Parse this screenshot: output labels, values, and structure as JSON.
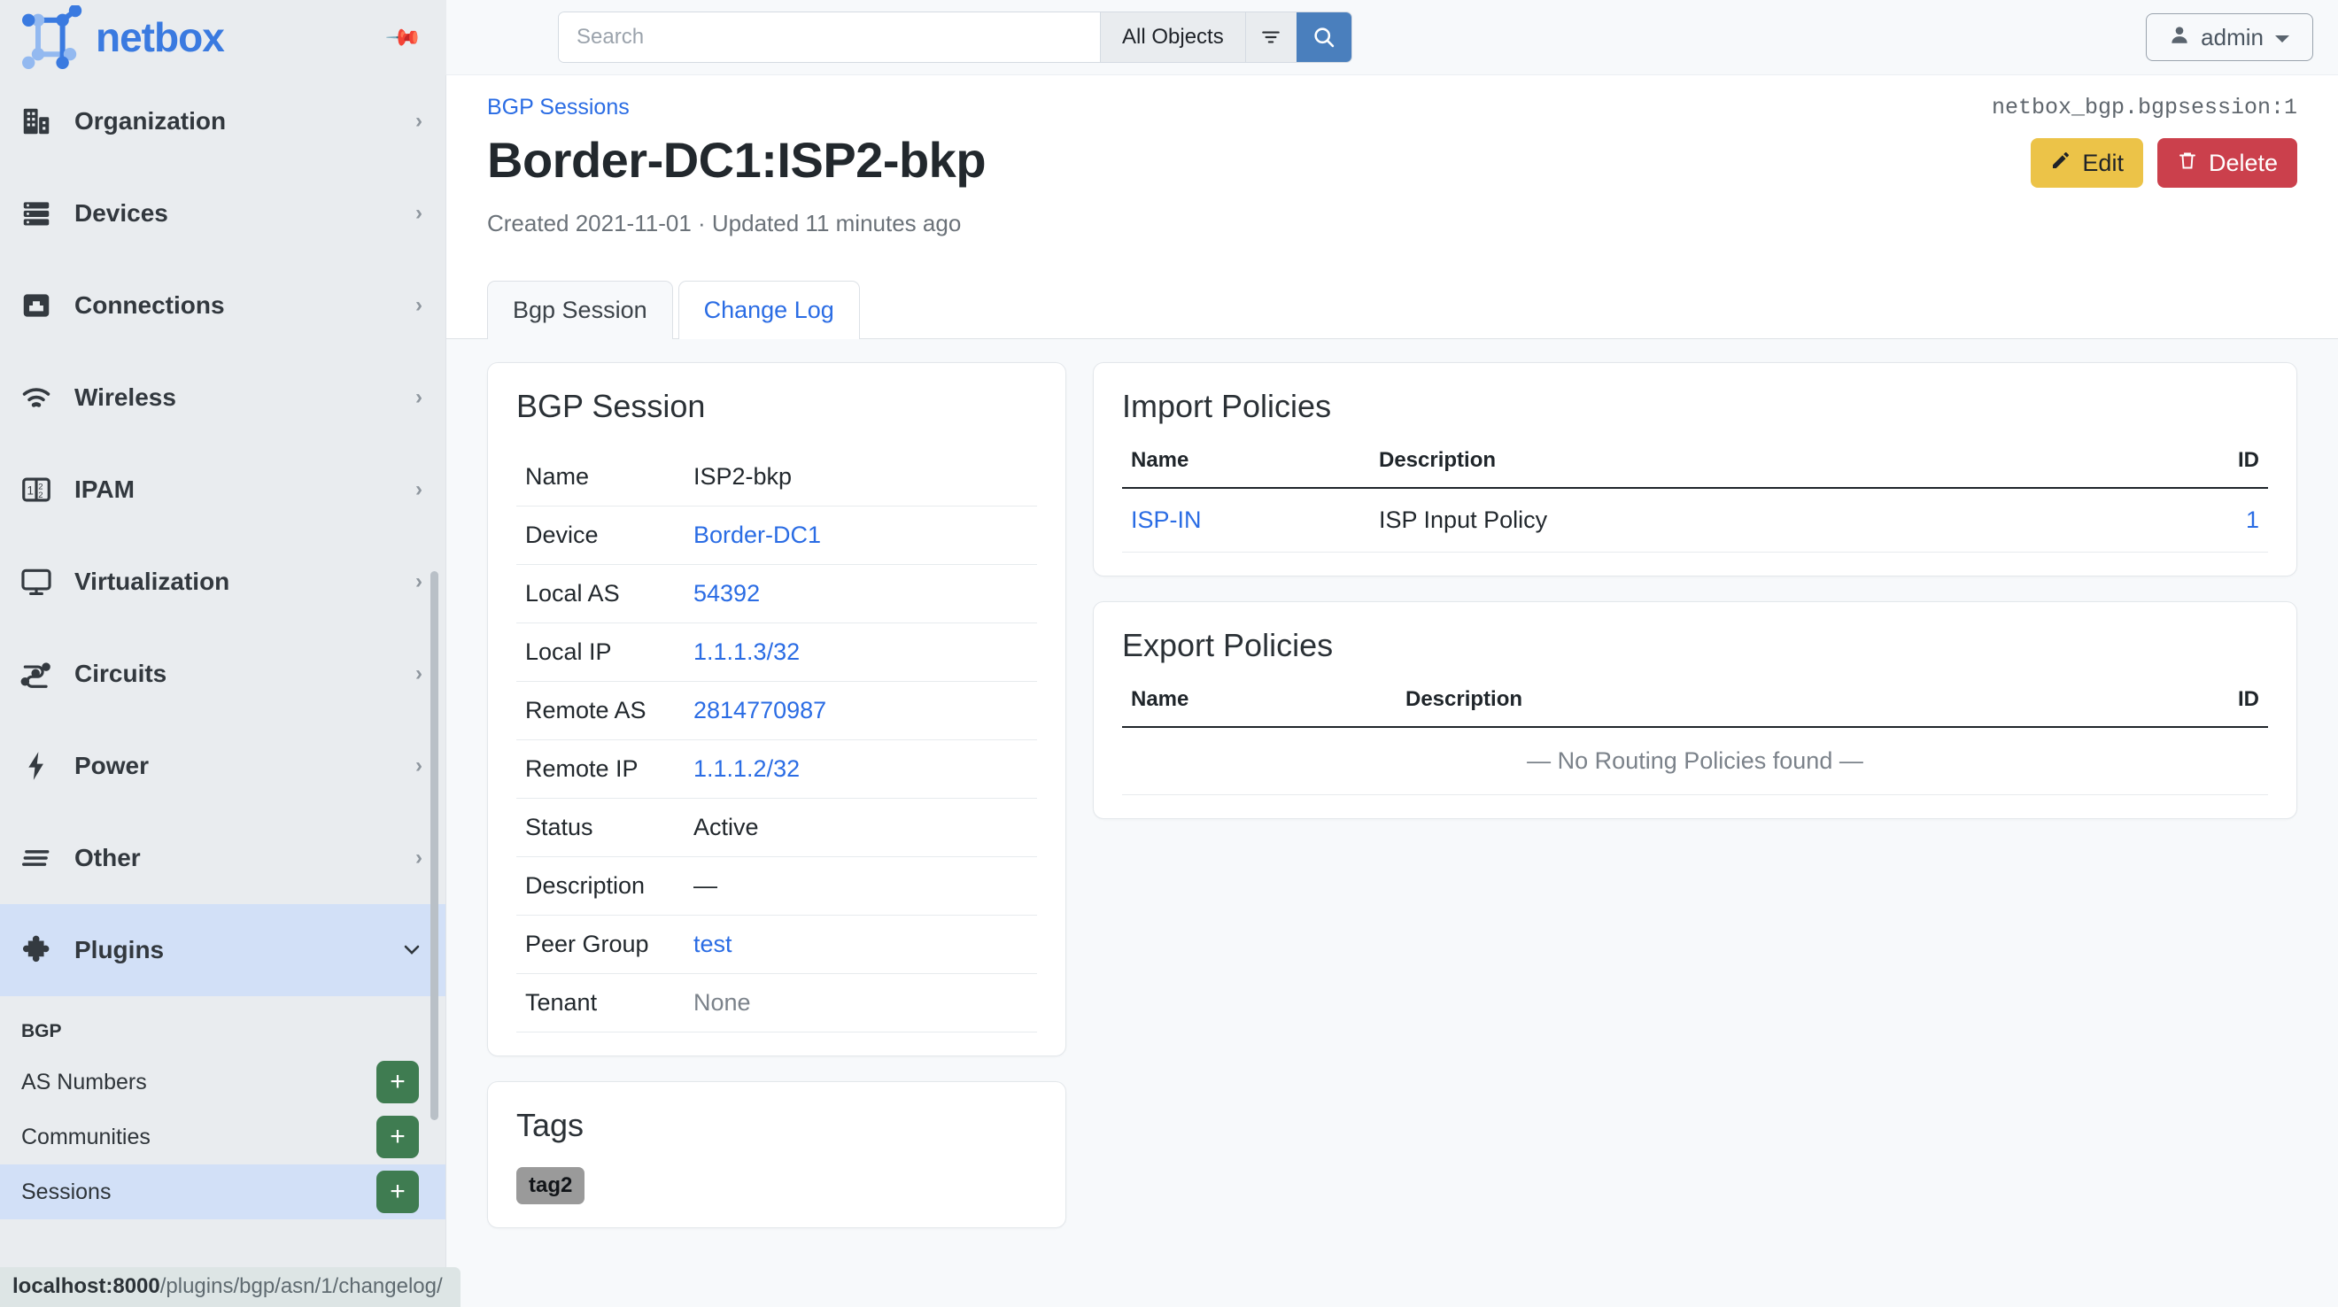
{
  "brand": {
    "name": "netbox",
    "pin_icon": "pin-icon"
  },
  "search": {
    "placeholder": "Search",
    "value": "",
    "scope_label": "All Objects",
    "filter_icon": "filter-icon",
    "submit_icon": "search-icon"
  },
  "user": {
    "label": "admin",
    "avatar_icon": "user-icon",
    "caret_icon": "chevron-down-icon"
  },
  "sidebar": {
    "items": [
      {
        "label": "Organization",
        "icon": "organization-icon",
        "chevron": "›",
        "active": false
      },
      {
        "label": "Devices",
        "icon": "devices-icon",
        "chevron": "›",
        "active": false
      },
      {
        "label": "Connections",
        "icon": "connections-icon",
        "chevron": "›",
        "active": false
      },
      {
        "label": "Wireless",
        "icon": "wireless-icon",
        "chevron": "›",
        "active": false
      },
      {
        "label": "IPAM",
        "icon": "ipam-icon",
        "chevron": "›",
        "active": false
      },
      {
        "label": "Virtualization",
        "icon": "virtualization-icon",
        "chevron": "›",
        "active": false
      },
      {
        "label": "Circuits",
        "icon": "circuits-icon",
        "chevron": "›",
        "active": false
      },
      {
        "label": "Power",
        "icon": "power-icon",
        "chevron": "›",
        "active": false
      },
      {
        "label": "Other",
        "icon": "other-icon",
        "chevron": "›",
        "active": false
      },
      {
        "label": "Plugins",
        "icon": "plugins-icon",
        "chevron": "⌄",
        "active": true
      }
    ],
    "section": {
      "label": "BGP"
    },
    "sub_items": [
      {
        "label": "AS Numbers",
        "add_label": "+",
        "active": false
      },
      {
        "label": "Communities",
        "add_label": "+",
        "active": false
      },
      {
        "label": "Sessions",
        "add_label": "+",
        "active": true
      }
    ]
  },
  "statusbar": {
    "host": "localhost:8000",
    "path": "/plugins/bgp/asn/1/changelog/"
  },
  "page": {
    "breadcrumb": "BGP Sessions",
    "object_id": "netbox_bgp.bgpsession:1",
    "title": "Border-DC1:ISP2-bkp",
    "meta": "Created 2021-11-01 · Updated 11 minutes ago",
    "edit_label": "Edit",
    "edit_icon": "pencil-icon",
    "delete_label": "Delete",
    "delete_icon": "trash-icon",
    "tabs": [
      {
        "label": "Bgp Session",
        "active": true
      },
      {
        "label": "Change Log",
        "active": false
      }
    ]
  },
  "bgp_session_card": {
    "title": "BGP Session",
    "rows": [
      {
        "key": "Name",
        "value": "ISP2-bkp",
        "link": false,
        "muted": false
      },
      {
        "key": "Device",
        "value": "Border-DC1",
        "link": true,
        "muted": false
      },
      {
        "key": "Local AS",
        "value": "54392",
        "link": true,
        "muted": false
      },
      {
        "key": "Local IP",
        "value": "1.1.1.3/32",
        "link": true,
        "muted": false
      },
      {
        "key": "Remote AS",
        "value": "2814770987",
        "link": true,
        "muted": false
      },
      {
        "key": "Remote IP",
        "value": "1.1.1.2/32",
        "link": true,
        "muted": false
      },
      {
        "key": "Status",
        "value": "Active",
        "link": false,
        "muted": false
      },
      {
        "key": "Description",
        "value": "—",
        "link": false,
        "muted": false
      },
      {
        "key": "Peer Group",
        "value": "test",
        "link": true,
        "muted": false
      },
      {
        "key": "Tenant",
        "value": "None",
        "link": false,
        "muted": true
      }
    ]
  },
  "tags_card": {
    "title": "Tags",
    "tags": [
      "tag2"
    ]
  },
  "import_policies": {
    "title": "Import Policies",
    "columns": [
      "Name",
      "Description",
      "ID"
    ],
    "rows": [
      {
        "name": "ISP-IN",
        "description": "ISP Input Policy",
        "id": "1"
      }
    ],
    "empty_text": ""
  },
  "export_policies": {
    "title": "Export Policies",
    "columns": [
      "Name",
      "Description",
      "ID"
    ],
    "rows": [],
    "empty_text": "— No Routing Policies found —"
  },
  "colors": {
    "brand_blue": "#3a7ae0",
    "link_blue": "#2a6ce4",
    "edit_yellow": "#ecc348",
    "delete_red": "#cb404c",
    "add_green": "#3f7c51",
    "active_nav": "#d2e0f7",
    "sidebar_bg": "#e9ecef"
  }
}
